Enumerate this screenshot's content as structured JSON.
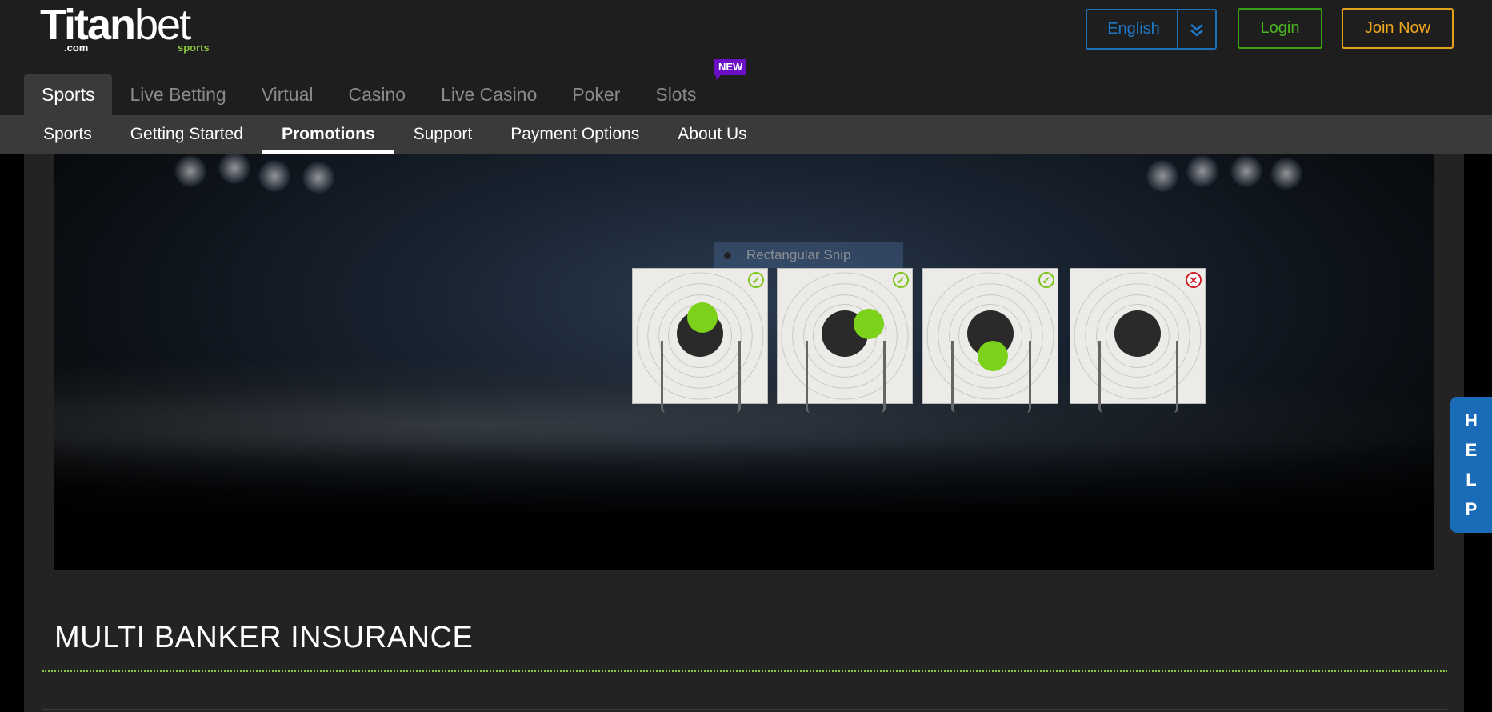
{
  "logo": {
    "text_bold": "Titan",
    "text_light": "bet",
    "com": ".com",
    "sports": "sports"
  },
  "header": {
    "language": "English",
    "login": "Login",
    "join": "Join Now"
  },
  "main_nav": [
    {
      "label": "Sports"
    },
    {
      "label": "Live Betting"
    },
    {
      "label": "Virtual"
    },
    {
      "label": "Casino"
    },
    {
      "label": "Live Casino"
    },
    {
      "label": "Poker"
    },
    {
      "label": "Slots"
    }
  ],
  "new_badge": "NEW",
  "sub_nav": [
    {
      "label": "Sports"
    },
    {
      "label": "Getting Started"
    },
    {
      "label": "Promotions"
    },
    {
      "label": "Support"
    },
    {
      "label": "Payment Options"
    },
    {
      "label": "About Us"
    }
  ],
  "snip_overlay": "Rectangular Snip",
  "help": [
    "H",
    "E",
    "L",
    "P"
  ],
  "page_heading": "MULTI BANKER INSURANCE",
  "colors": {
    "accent_green": "#8cc63f",
    "lang_blue": "#1d6fb8",
    "login_green": "#3aa016",
    "join_orange": "#e5a019",
    "new_purple": "#6a0fc5",
    "help_blue": "#1a6bb8"
  }
}
